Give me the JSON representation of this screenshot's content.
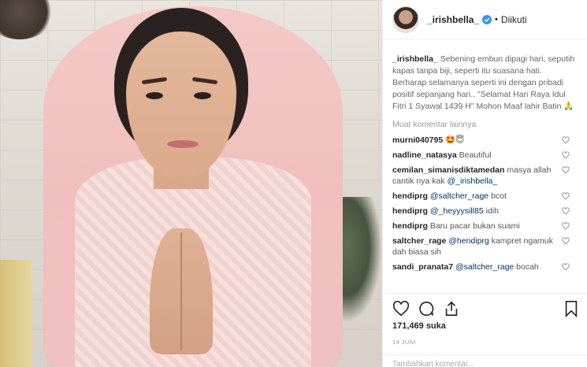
{
  "post": {
    "username": "_irishbella_",
    "follow_separator": "•",
    "follow_status": "Diikuti",
    "caption_user": "_irishbella_",
    "caption_text": " Sebening embun dipagi hari, seputih kapas tanpa biji, seperti itu suasana hati. Berharap selamanya seperti ini dengan pribadi positif sepanjang hari.. \"Selamat Hari Raya Idul Fitri 1 Syawal 1439 H\" Mohon Maaf lahir Batin 🙏",
    "more_comments": "Muat komentar lainnya",
    "likes": "171,469 suka",
    "date": "14 JUNI",
    "add_comment_placeholder": "Tambahkan komentar..."
  },
  "comments": [
    {
      "user": "murni040795",
      "pre": " ",
      "mention": "",
      "text": "🤩😇"
    },
    {
      "user": "nadline_natasya",
      "pre": " ",
      "mention": "",
      "text": "Beautiful"
    },
    {
      "user": "cemilan_simanisdiktamedan",
      "pre": " masya allah cantik nya kak ",
      "mention": "@_irishbella_",
      "text": ""
    },
    {
      "user": "hendiprg",
      "pre": " ",
      "mention": "@saltcher_rage",
      "text": " bcot"
    },
    {
      "user": "hendiprg",
      "pre": " ",
      "mention": "@_heyyysill85",
      "text": " idih"
    },
    {
      "user": "hendiprg",
      "pre": " ",
      "mention": "",
      "text": "Baru pacar bukan suami"
    },
    {
      "user": "saltcher_rage",
      "pre": " ",
      "mention": "@hendiprg",
      "text": " kampret ngamuk dah biasa sih"
    },
    {
      "user": "sandi_pranata7",
      "pre": " ",
      "mention": "@saltcher_rage",
      "text": " bocah"
    }
  ],
  "icons": {
    "verified": "verified-badge-icon",
    "heart": "heart-outline-icon",
    "comment": "comment-bubble-icon",
    "share": "share-arrow-icon",
    "save": "bookmark-icon"
  },
  "colors": {
    "verified": "#3897f0",
    "mention": "#003569",
    "muted": "#999999"
  }
}
